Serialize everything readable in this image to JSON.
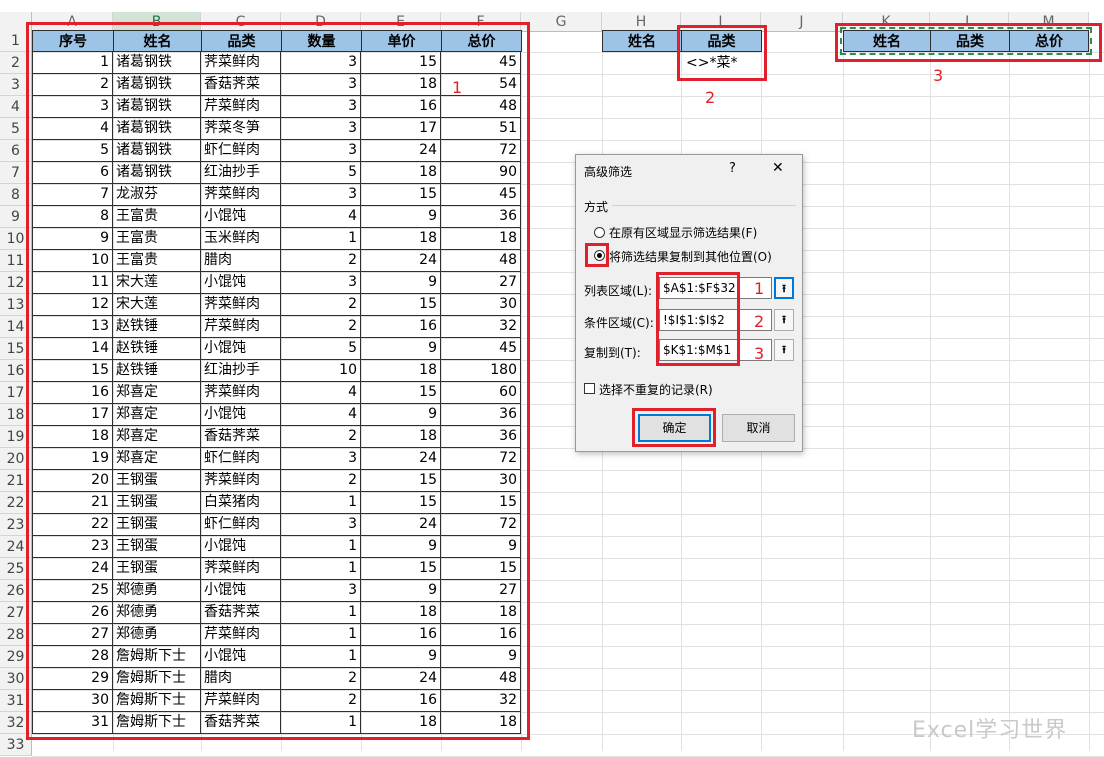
{
  "columns": [
    "A",
    "B",
    "C",
    "D",
    "E",
    "F",
    "G",
    "H",
    "I",
    "J",
    "K",
    "L",
    "M"
  ],
  "row_numbers": [
    "1",
    "2",
    "3",
    "4",
    "5",
    "6",
    "7",
    "8",
    "9",
    "10",
    "11",
    "12",
    "13",
    "14",
    "15",
    "16",
    "17",
    "18",
    "19",
    "20",
    "21",
    "22",
    "23",
    "24",
    "25",
    "26",
    "27",
    "28",
    "29",
    "30",
    "31",
    "32",
    "33"
  ],
  "table": {
    "headers": [
      "序号",
      "姓名",
      "品类",
      "数量",
      "单价",
      "总价"
    ],
    "rows": [
      [
        "1",
        "诸葛钢铁",
        "荠菜鲜肉",
        "3",
        "15",
        "45"
      ],
      [
        "2",
        "诸葛钢铁",
        "香菇荠菜",
        "3",
        "18",
        "54"
      ],
      [
        "3",
        "诸葛钢铁",
        "芹菜鲜肉",
        "3",
        "16",
        "48"
      ],
      [
        "4",
        "诸葛钢铁",
        "荠菜冬笋",
        "3",
        "17",
        "51"
      ],
      [
        "5",
        "诸葛钢铁",
        "虾仁鲜肉",
        "3",
        "24",
        "72"
      ],
      [
        "6",
        "诸葛钢铁",
        "红油抄手",
        "5",
        "18",
        "90"
      ],
      [
        "7",
        "龙淑芬",
        "荠菜鲜肉",
        "3",
        "15",
        "45"
      ],
      [
        "8",
        "王富贵",
        "小馄饨",
        "4",
        "9",
        "36"
      ],
      [
        "9",
        "王富贵",
        "玉米鲜肉",
        "1",
        "18",
        "18"
      ],
      [
        "10",
        "王富贵",
        "腊肉",
        "2",
        "24",
        "48"
      ],
      [
        "11",
        "宋大莲",
        "小馄饨",
        "3",
        "9",
        "27"
      ],
      [
        "12",
        "宋大莲",
        "荠菜鲜肉",
        "2",
        "15",
        "30"
      ],
      [
        "13",
        "赵铁锤",
        "芹菜鲜肉",
        "2",
        "16",
        "32"
      ],
      [
        "14",
        "赵铁锤",
        "小馄饨",
        "5",
        "9",
        "45"
      ],
      [
        "15",
        "赵铁锤",
        "红油抄手",
        "10",
        "18",
        "180"
      ],
      [
        "16",
        "郑喜定",
        "荠菜鲜肉",
        "4",
        "15",
        "60"
      ],
      [
        "17",
        "郑喜定",
        "小馄饨",
        "4",
        "9",
        "36"
      ],
      [
        "18",
        "郑喜定",
        "香菇荠菜",
        "2",
        "18",
        "36"
      ],
      [
        "19",
        "郑喜定",
        "虾仁鲜肉",
        "3",
        "24",
        "72"
      ],
      [
        "20",
        "王钢蛋",
        "荠菜鲜肉",
        "2",
        "15",
        "30"
      ],
      [
        "21",
        "王钢蛋",
        "白菜猪肉",
        "1",
        "15",
        "15"
      ],
      [
        "22",
        "王钢蛋",
        "虾仁鲜肉",
        "3",
        "24",
        "72"
      ],
      [
        "23",
        "王钢蛋",
        "小馄饨",
        "1",
        "9",
        "9"
      ],
      [
        "24",
        "王钢蛋",
        "荠菜鲜肉",
        "1",
        "15",
        "15"
      ],
      [
        "25",
        "郑德勇",
        "小馄饨",
        "3",
        "9",
        "27"
      ],
      [
        "26",
        "郑德勇",
        "香菇荠菜",
        "1",
        "18",
        "18"
      ],
      [
        "27",
        "郑德勇",
        "芹菜鲜肉",
        "1",
        "16",
        "16"
      ],
      [
        "28",
        "詹姆斯下士",
        "小馄饨",
        "1",
        "9",
        "9"
      ],
      [
        "29",
        "詹姆斯下士",
        "腊肉",
        "2",
        "24",
        "48"
      ],
      [
        "30",
        "詹姆斯下士",
        "芹菜鲜肉",
        "2",
        "16",
        "32"
      ],
      [
        "31",
        "詹姆斯下士",
        "香菇荠菜",
        "1",
        "18",
        "18"
      ]
    ]
  },
  "criteria": {
    "headers": [
      "姓名",
      "品类"
    ],
    "value": "<>*菜*"
  },
  "output": {
    "headers": [
      "姓名",
      "品类",
      "总价"
    ]
  },
  "annotations": {
    "one": "1",
    "two": "2",
    "three": "3"
  },
  "dialog": {
    "title": "高级筛选",
    "help": "?",
    "close": "✕",
    "section_label": "方式",
    "radio_inplace": "在原有区域显示筛选结果(F)",
    "radio_copy": "将筛选结果复制到其他位置(O)",
    "list_range_label": "列表区域(L):",
    "list_range_value": "$A$1:$F$32",
    "criteria_range_label": "条件区域(C):",
    "criteria_range_value": "!$I$1:$I$2",
    "copy_to_label": "复制到(T):",
    "copy_to_value": "$K$1:$M$1",
    "unique_label": "选择不重复的记录(R)",
    "ok": "确定",
    "cancel": "取消",
    "picker_icon": "collapse-dialog-icon"
  },
  "watermark": "Excel学习世界",
  "colors": {
    "header_fill": "#9dc3e6",
    "annotation_red": "#e0202a",
    "selection_green": "#2e8b57"
  }
}
